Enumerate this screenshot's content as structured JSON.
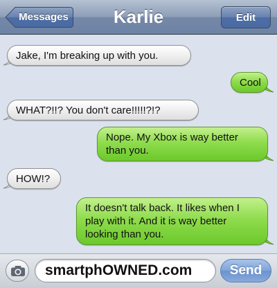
{
  "nav": {
    "back_label": "Messages",
    "title": "Karlie",
    "edit_label": "Edit"
  },
  "messages": [
    {
      "side": "incoming",
      "text": "Jake, I'm breaking up with you."
    },
    {
      "side": "outgoing",
      "text": "Cool"
    },
    {
      "side": "incoming",
      "text": "WHAT?!!? You don't care!!!!!?!?"
    },
    {
      "side": "outgoing",
      "text": "Nope. My Xbox is way better than you."
    },
    {
      "side": "incoming",
      "text": "HOW!?"
    },
    {
      "side": "outgoing",
      "text": "It doesn't talk back. It likes when I play with it. And it is way better looking than you."
    }
  ],
  "compose": {
    "camera_icon": "camera-icon",
    "field_value": "smartphOWNED.com",
    "send_label": "Send"
  },
  "colors": {
    "incoming_bubble": "#e8e8e8",
    "outgoing_bubble": "#8fdc4d",
    "background": "#dbe2ed",
    "navbar": "#7588a7",
    "send_button": "#7fa4d8"
  }
}
